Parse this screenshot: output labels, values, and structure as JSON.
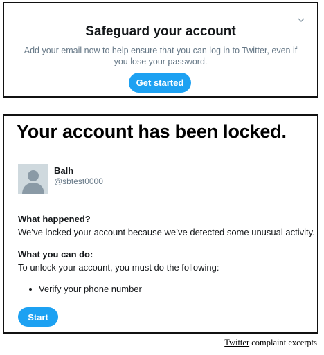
{
  "safeguard_prompt": {
    "title": "Safeguard your account",
    "description": "Add your email now to help ensure that you can log in to Twitter, even if you lose your password.",
    "button_label": "Get started",
    "collapse_icon": "chevron-down-icon"
  },
  "locked_notice": {
    "headline": "Your account has been locked.",
    "account": {
      "name": "Balh",
      "handle": "@sbtest0000",
      "avatar_icon": "default-avatar-icon"
    },
    "what_happened": {
      "heading": "What happened?",
      "text": "We’ve locked your account because we’ve detected some unusual activity."
    },
    "what_you_can_do": {
      "heading": "What you can do:",
      "text": "To unlock your account, you must do the following:",
      "steps": [
        "Verify your phone number"
      ]
    },
    "button_label": "Start"
  },
  "caption": {
    "link_text": "Twitter",
    "text": " complaint excerpts"
  },
  "colors": {
    "accent": "#1da1f2",
    "secondary_text": "#657786",
    "avatar_bg": "#cfd9de"
  }
}
